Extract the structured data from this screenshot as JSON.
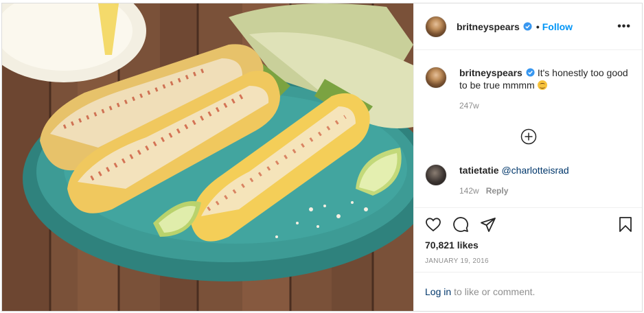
{
  "post": {
    "author": "britneyspears",
    "follow_label": "Follow",
    "separator": "•",
    "more_label": "•••"
  },
  "caption": {
    "username": "britneyspears",
    "text": "It's honestly too good to be true mmmm",
    "emoji": "smiling-face-emoji",
    "time": "247w"
  },
  "comments": [
    {
      "username": "tatietatie",
      "text": "@charlotteisrad",
      "time": "142w",
      "reply_label": "Reply"
    }
  ],
  "load_more_icon": "plus-circle-icon",
  "actions": {
    "icons": [
      "heart-icon",
      "comment-icon",
      "share-icon",
      "bookmark-icon"
    ],
    "likes": "70,821 likes",
    "date": "JANUARY 19, 2016"
  },
  "login": {
    "link_label": "Log in",
    "suffix": "to like or comment."
  },
  "colors": {
    "link_blue": "#0095f6",
    "verified_blue": "#3897f0",
    "plate_teal": "#3d9b95"
  }
}
